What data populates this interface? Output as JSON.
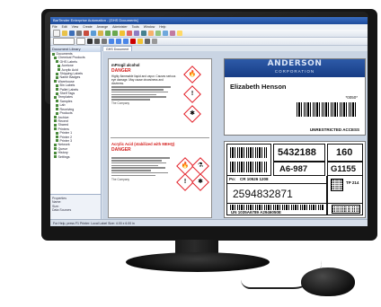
{
  "app": {
    "title": "BarTender Enterprise Automation - [GHS Documents]",
    "menu": [
      "File",
      "Edit",
      "View",
      "Create",
      "Arrange",
      "Administer",
      "Tools",
      "Window",
      "Help"
    ],
    "left_panel": {
      "header": "Document Library",
      "items": [
        "Documents",
        "Chemical Products",
        "GHS Labels",
        "Acetone",
        "Acrylic Acid",
        "Shipping Labels",
        "Name Badges",
        "Warehouse",
        "Bin Labels",
        "Pallet Labels",
        "Shelf Tags",
        "Templates",
        "Samples",
        "Lab",
        "Receiving",
        "Products",
        "Archive",
        "Recent",
        "Shared",
        "Printers",
        "Printer 1",
        "Printer 2",
        "Printer 3",
        "Network",
        "Queue",
        "History",
        "Settings"
      ],
      "bottom": [
        "Properties",
        "Name:",
        "Size:",
        "Data Sources"
      ]
    },
    "tab_label": "GHS Document",
    "status": "For Help, press F1    Printer: Local    Label Size: 4.00 x 6.00 in"
  },
  "ghs_label": {
    "product1": "mProgil alcohol",
    "signal1": "DANGER",
    "hazard1": "Highly flammable liquid and vapor. Causes serious eye damage. May cause drowsiness and dizziness.",
    "company1": "The Company",
    "product2": "Acrylic Acid (stabilized with MEHQ)",
    "signal2": "DANGER",
    "company2": "The Company"
  },
  "name_card": {
    "org_line1": "ANDERSON",
    "org_line2": "CORPORATION",
    "name": "Elizabeth Henson",
    "code": "*0050*",
    "restriction": "UNRESTRICTED ACCESS"
  },
  "shipping_label": {
    "qty": "160",
    "order": "5432188",
    "ref": "A6-987",
    "loc": "G1155",
    "po_prefix": "Po:",
    "po": "CR 10526 1208",
    "serial": "2594832871",
    "lot": "TP 214",
    "sscc": "UN 1035A6789 A2946050E"
  },
  "colors": {
    "ghs_red": "#e31b23",
    "card_blue": "#1f4a96",
    "title_blue": "#1d4a9a"
  },
  "icons": [
    "flame-icon",
    "corrosion-icon",
    "exclamation-icon",
    "health-hazard-icon"
  ]
}
